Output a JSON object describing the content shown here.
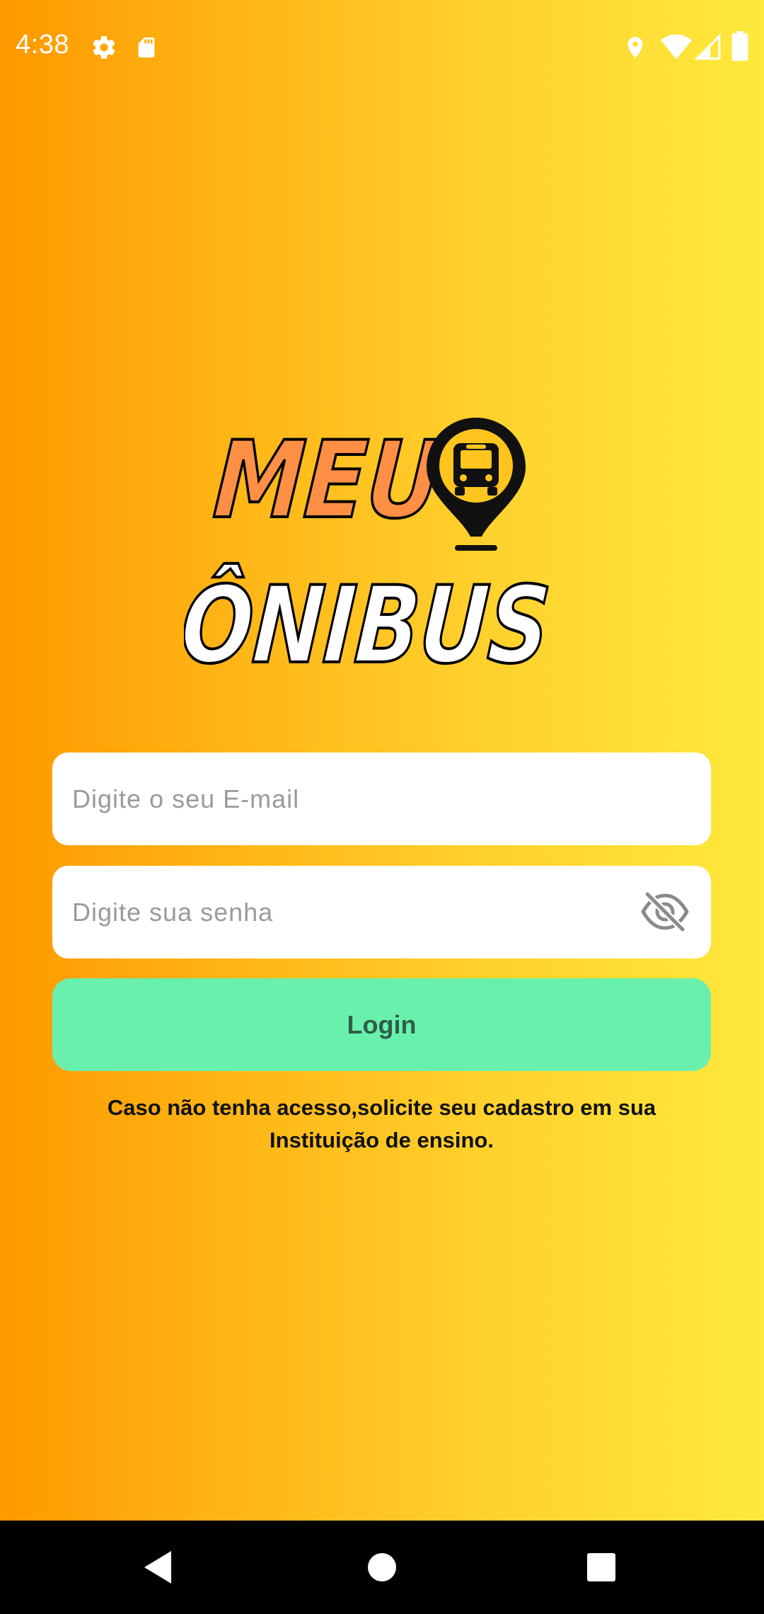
{
  "status_bar": {
    "time": "4:38",
    "icons": [
      "gear-icon",
      "sd-card-icon",
      "location-icon",
      "wifi-icon",
      "cell-signal-icon",
      "battery-icon"
    ]
  },
  "logo": {
    "line1": "MEU",
    "line2": "ÔNIBUS",
    "icon": "bus-pin-icon",
    "colors": {
      "line1": "#ff8f45",
      "line2": "#ffffff",
      "outline": "#000000"
    }
  },
  "form": {
    "email": {
      "placeholder": "Digite o seu E-mail",
      "value": ""
    },
    "password": {
      "placeholder": "Digite sua senha",
      "value": "",
      "toggle_icon": "eye-off-icon"
    },
    "login_label": "Login",
    "notice": "Caso não tenha acesso,solicite seu cadastro em sua Instituição de ensino."
  },
  "colors": {
    "gradient_start": "#ff9900",
    "gradient_end": "#ffe93d",
    "button": "#6af0ad",
    "button_text": "#2e5e49"
  },
  "nav_bar": {
    "buttons": [
      "back-icon",
      "home-icon",
      "recents-icon"
    ]
  }
}
